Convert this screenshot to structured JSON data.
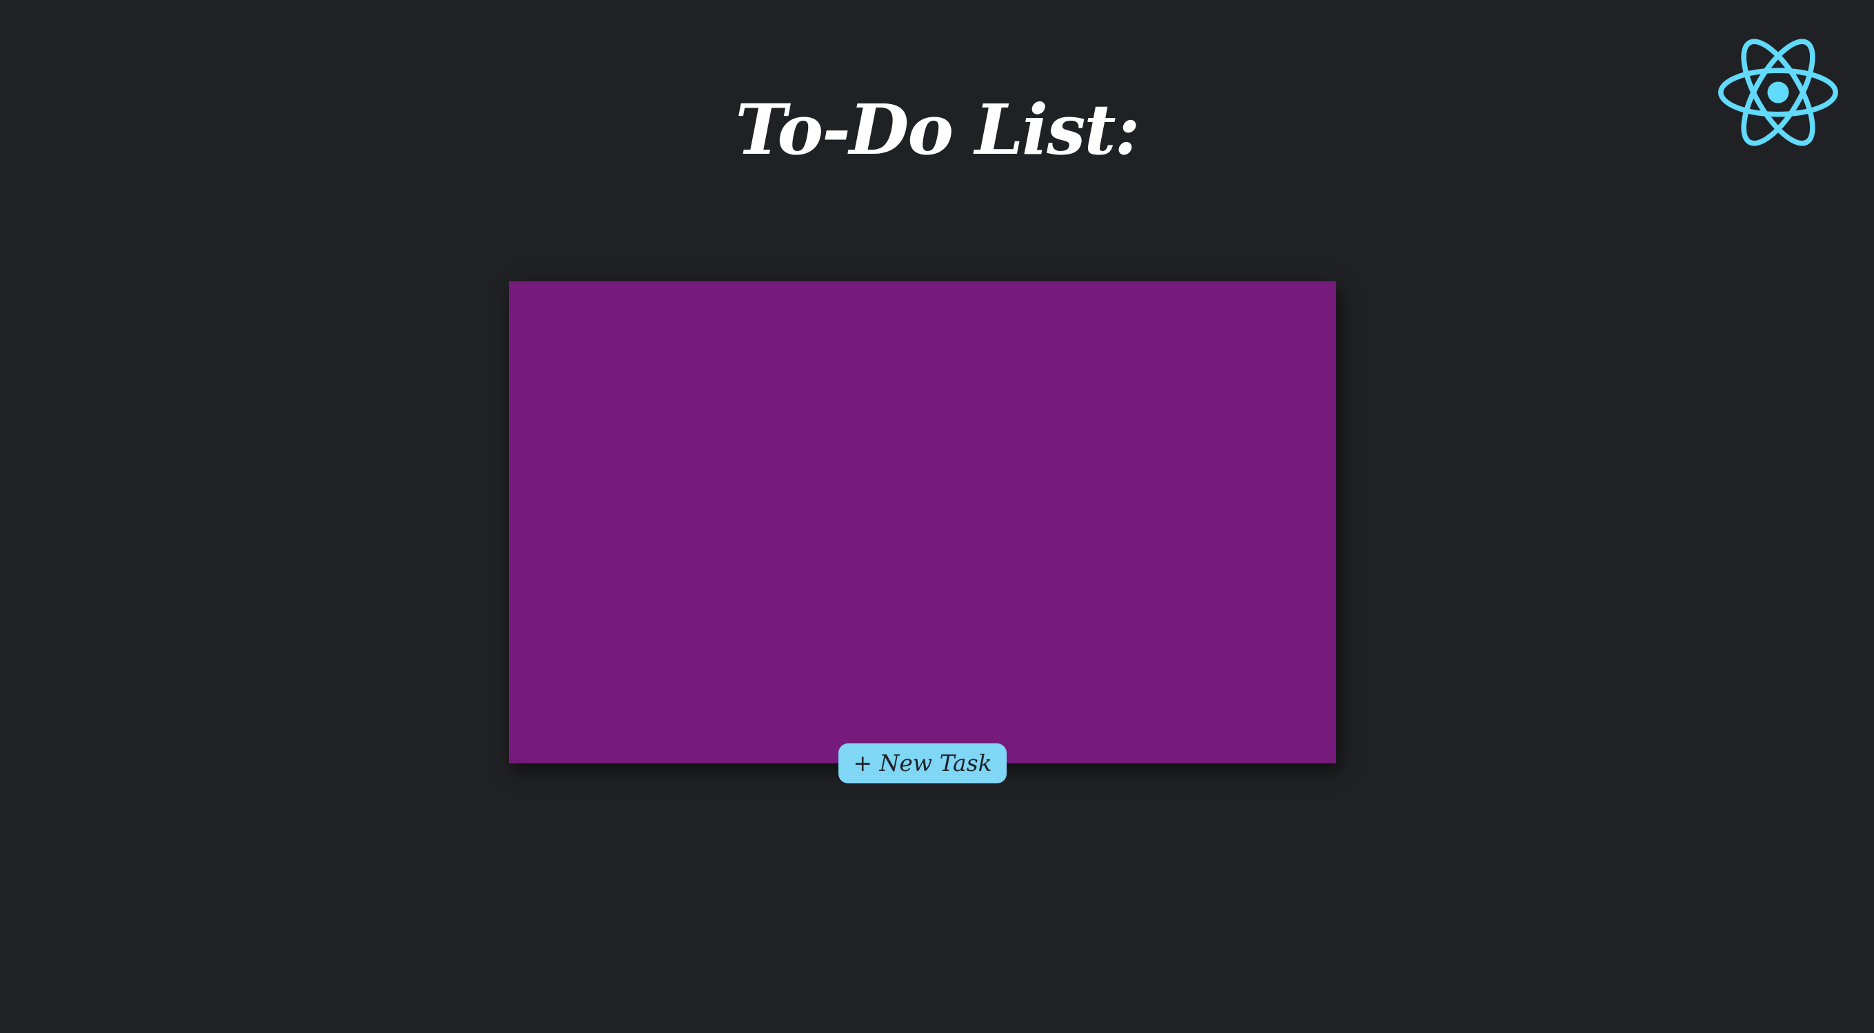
{
  "app": {
    "logo_icon": "react-atom-icon",
    "logo_color": "#61dafb"
  },
  "header": {
    "title": "To-Do List:"
  },
  "task_panel": {
    "background": "#761b7c",
    "tasks": []
  },
  "actions": {
    "new_task_label": "+ New Task",
    "button_color": "#7fd6f5"
  },
  "theme": {
    "background": "#202124"
  }
}
